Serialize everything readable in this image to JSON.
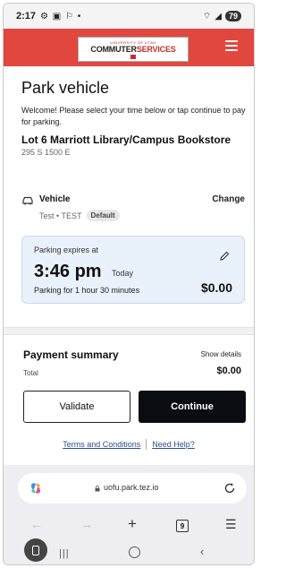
{
  "status_bar": {
    "time": "2:17",
    "battery": "79"
  },
  "header": {
    "logo_small": "UNIVERSITY OF UTAH",
    "logo_part1": "COMMUTER",
    "logo_part2": "SERVICES",
    "menu_icon": "hamburger-menu-icon"
  },
  "page": {
    "title": "Park vehicle",
    "welcome": "Welcome! Please select your time below or tap continue to pay for parking.",
    "lot_name": "Lot 6 Marriott Library/Campus Bookstore",
    "lot_address": "295 S 1500 E"
  },
  "vehicle": {
    "label": "Vehicle",
    "change": "Change",
    "plate": "Test • TEST",
    "badge": "Default"
  },
  "parking": {
    "expires_label": "Parking expires at",
    "time": "3:46 pm",
    "day": "Today",
    "duration": "Parking for 1 hour 30 minutes",
    "price": "$0.00"
  },
  "payment": {
    "title": "Payment summary",
    "show_details": "Show details",
    "total_label": "Total",
    "total_value": "$0.00"
  },
  "buttons": {
    "validate": "Validate",
    "continue": "Continue"
  },
  "links": {
    "terms": "Terms and Conditions",
    "help": "Need Help?"
  },
  "browser": {
    "url": "uofu.park.tez.io",
    "tab_count": "9"
  },
  "colors": {
    "header": "#e1473f",
    "primary_button": "#0b0b12",
    "card_bg": "#e9f1fb",
    "link": "#2b4d8f"
  }
}
